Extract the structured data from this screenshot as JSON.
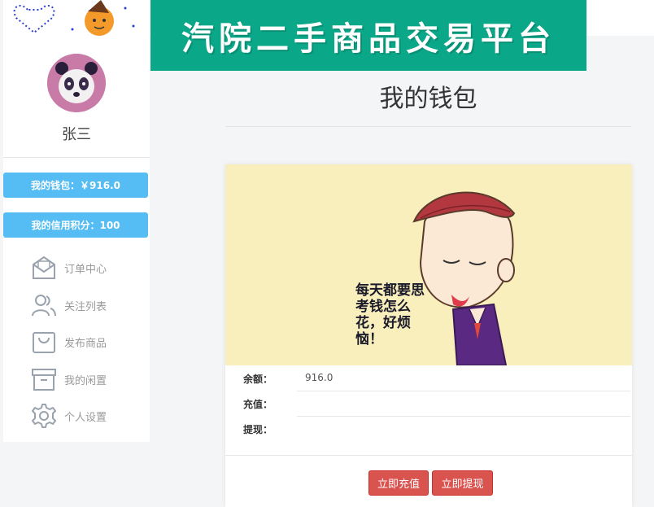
{
  "banner": {
    "title": "汽院二手商品交易平台"
  },
  "user": {
    "name": "张三"
  },
  "sidebar": {
    "wallet_label": "我的钱包：￥916.0",
    "credit_label": "我的信用积分：100",
    "items": [
      {
        "label": "订单中心",
        "icon": "envelope-icon"
      },
      {
        "label": "关注列表",
        "icon": "users-icon"
      },
      {
        "label": "发布商品",
        "icon": "shopping-bag-icon"
      },
      {
        "label": "我的闲置",
        "icon": "archive-box-icon"
      },
      {
        "label": "个人设置",
        "icon": "gear-icon"
      }
    ]
  },
  "main": {
    "title": "我的钱包",
    "illustration_text": "每天都要思考钱怎么花，好烦恼！",
    "rows": [
      {
        "label": "余额：",
        "value": "916.0"
      },
      {
        "label": "充值：",
        "value": ""
      },
      {
        "label": "提现：",
        "value": ""
      }
    ],
    "buttons": {
      "recharge": "立即充值",
      "withdraw": "立即提现"
    }
  },
  "colors": {
    "banner": "#0aa889",
    "sidebar_button": "#55bdf3",
    "action_button": "#d9534f",
    "illustration_bg": "#f8efbc"
  }
}
